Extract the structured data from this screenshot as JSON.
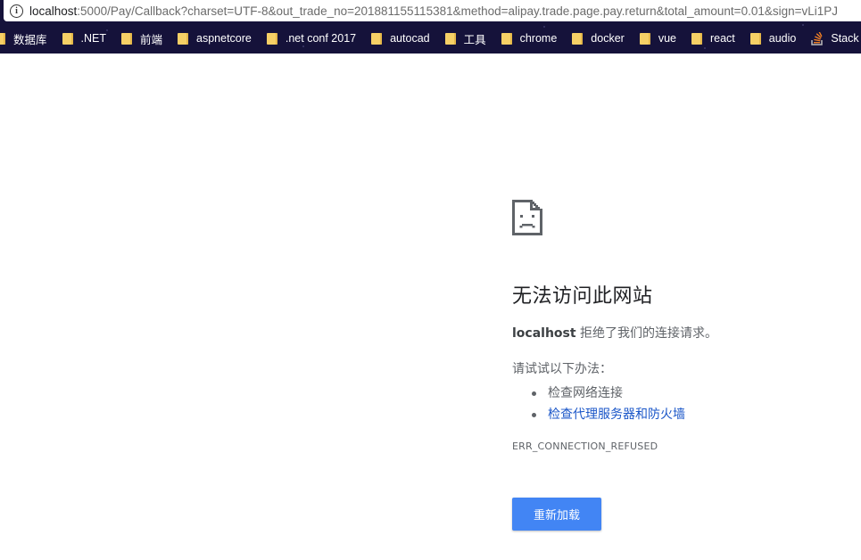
{
  "address_bar": {
    "host": "localhost",
    "rest": ":5000/Pay/Callback?charset=UTF-8&out_trade_no=201881155115381&method=alipay.trade.page.pay.return&total_amount=0.01&sign=vLi1PJ"
  },
  "bookmarks": [
    {
      "label": "数据库",
      "icon": "folder-icon"
    },
    {
      "label": ".NET",
      "icon": "folder-icon"
    },
    {
      "label": "前端",
      "icon": "folder-icon"
    },
    {
      "label": "aspnetcore",
      "icon": "folder-icon"
    },
    {
      "label": ".net conf 2017",
      "icon": "folder-icon"
    },
    {
      "label": "autocad",
      "icon": "folder-icon"
    },
    {
      "label": "工具",
      "icon": "folder-icon"
    },
    {
      "label": "chrome",
      "icon": "folder-icon"
    },
    {
      "label": "docker",
      "icon": "folder-icon"
    },
    {
      "label": "vue",
      "icon": "folder-icon"
    },
    {
      "label": "react",
      "icon": "folder-icon"
    },
    {
      "label": "audio",
      "icon": "folder-icon"
    },
    {
      "label": "Stack Overflow",
      "icon": "stack-overflow-icon"
    }
  ],
  "error_page": {
    "icon": "sad-page-icon",
    "title": "无法访问此网站",
    "host": "localhost",
    "description": " 拒绝了我们的连接请求。",
    "suggestions_heading": "请试试以下办法：",
    "suggestions": [
      {
        "text": "检查网络连接",
        "link": false
      },
      {
        "text": "检查代理服务器和防火墙",
        "link": true
      }
    ],
    "error_code": "ERR_CONNECTION_REFUSED",
    "reload_label": "重新加载"
  },
  "colors": {
    "toolbar_bg": "#15123a",
    "button_blue": "#4285f4",
    "link_blue": "#1a56c8",
    "folder_yellow": "#f6d066"
  }
}
